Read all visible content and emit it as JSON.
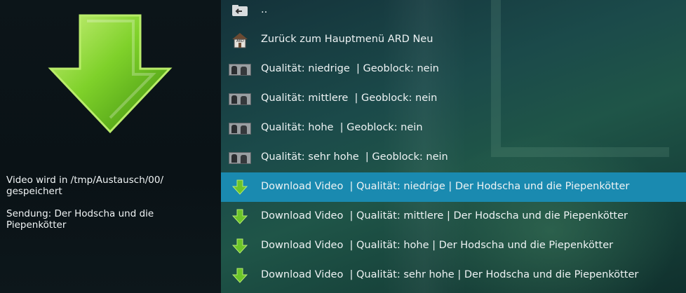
{
  "info": {
    "line1": "Video wird in /tmp/Austausch/00/ gespeichert",
    "line2": "Sendung: Der Hodscha und die Piepenkötter"
  },
  "list": {
    "items": [
      {
        "label": "..",
        "icon": "folder-back-icon"
      },
      {
        "label": "Zurück zum Hauptmenü ARD Neu",
        "icon": "ard-home-icon"
      },
      {
        "label": "Qualität: niedrige  | Geoblock: nein",
        "icon": "video-thumbnail-icon"
      },
      {
        "label": "Qualität: mittlere  | Geoblock: nein",
        "icon": "video-thumbnail-icon"
      },
      {
        "label": "Qualität: hohe  | Geoblock: nein",
        "icon": "video-thumbnail-icon"
      },
      {
        "label": "Qualität: sehr hohe  | Geoblock: nein",
        "icon": "video-thumbnail-icon"
      },
      {
        "label": "Download Video  | Qualität: niedrige | Der Hodscha und die Piepenkötter",
        "icon": "download-arrow-icon",
        "selected": true
      },
      {
        "label": "Download Video  | Qualität: mittlere | Der Hodscha und die Piepenkötter",
        "icon": "download-arrow-icon"
      },
      {
        "label": "Download Video  | Qualität: hohe | Der Hodscha und die Piepenkötter",
        "icon": "download-arrow-icon"
      },
      {
        "label": "Download Video  | Qualität: sehr hohe | Der Hodscha und die Piepenkötter",
        "icon": "download-arrow-icon"
      }
    ]
  },
  "colors": {
    "selected_row": "#1a8ab0",
    "arrow_green": "#5fbf1a"
  }
}
